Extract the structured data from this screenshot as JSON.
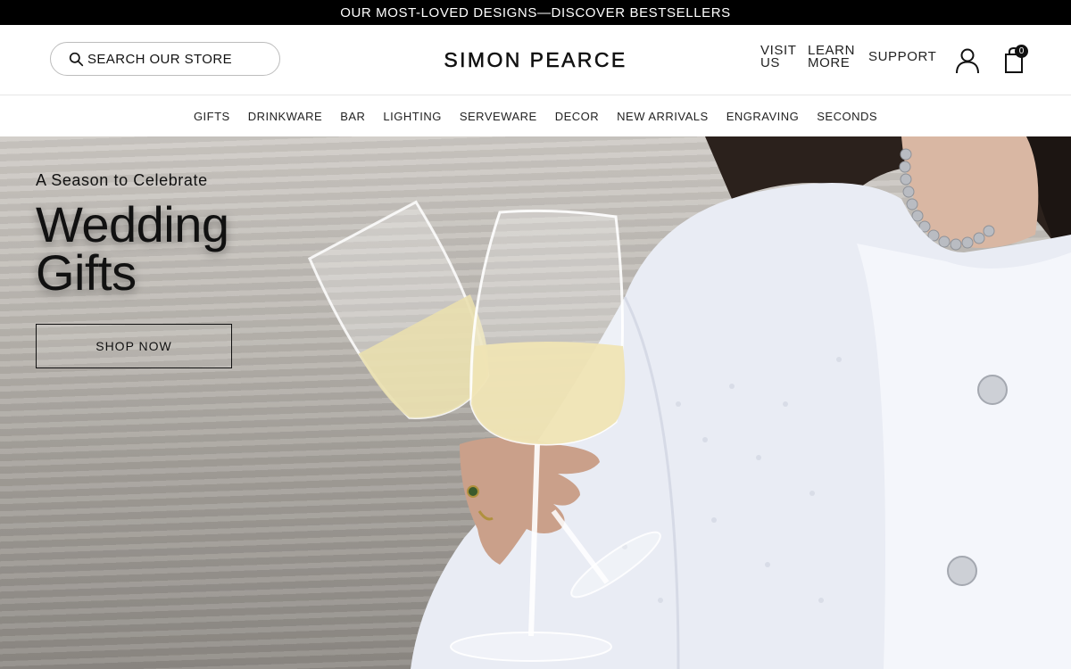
{
  "announcement": "OUR MOST-LOVED DESIGNS—DISCOVER BESTSELLERS",
  "header": {
    "search_placeholder": "SEARCH OUR STORE",
    "logo": "SIMON PEARCE",
    "utility": {
      "visit_line1": "VISIT",
      "visit_line2": "US",
      "learn_line1": "LEARN",
      "learn_line2": "MORE",
      "support": "SUPPORT"
    },
    "cart_count": "0"
  },
  "nav": [
    "GIFTS",
    "DRINKWARE",
    "BAR",
    "LIGHTING",
    "SERVEWARE",
    "DECOR",
    "NEW ARRIVALS",
    "ENGRAVING",
    "SECONDS"
  ],
  "hero": {
    "eyebrow": "A Season to Celebrate",
    "title_line1": "Wedding",
    "title_line2": "Gifts",
    "cta": "SHOP NOW"
  },
  "icons": {
    "search": "search-icon",
    "account": "account-icon",
    "cart": "cart-icon"
  }
}
